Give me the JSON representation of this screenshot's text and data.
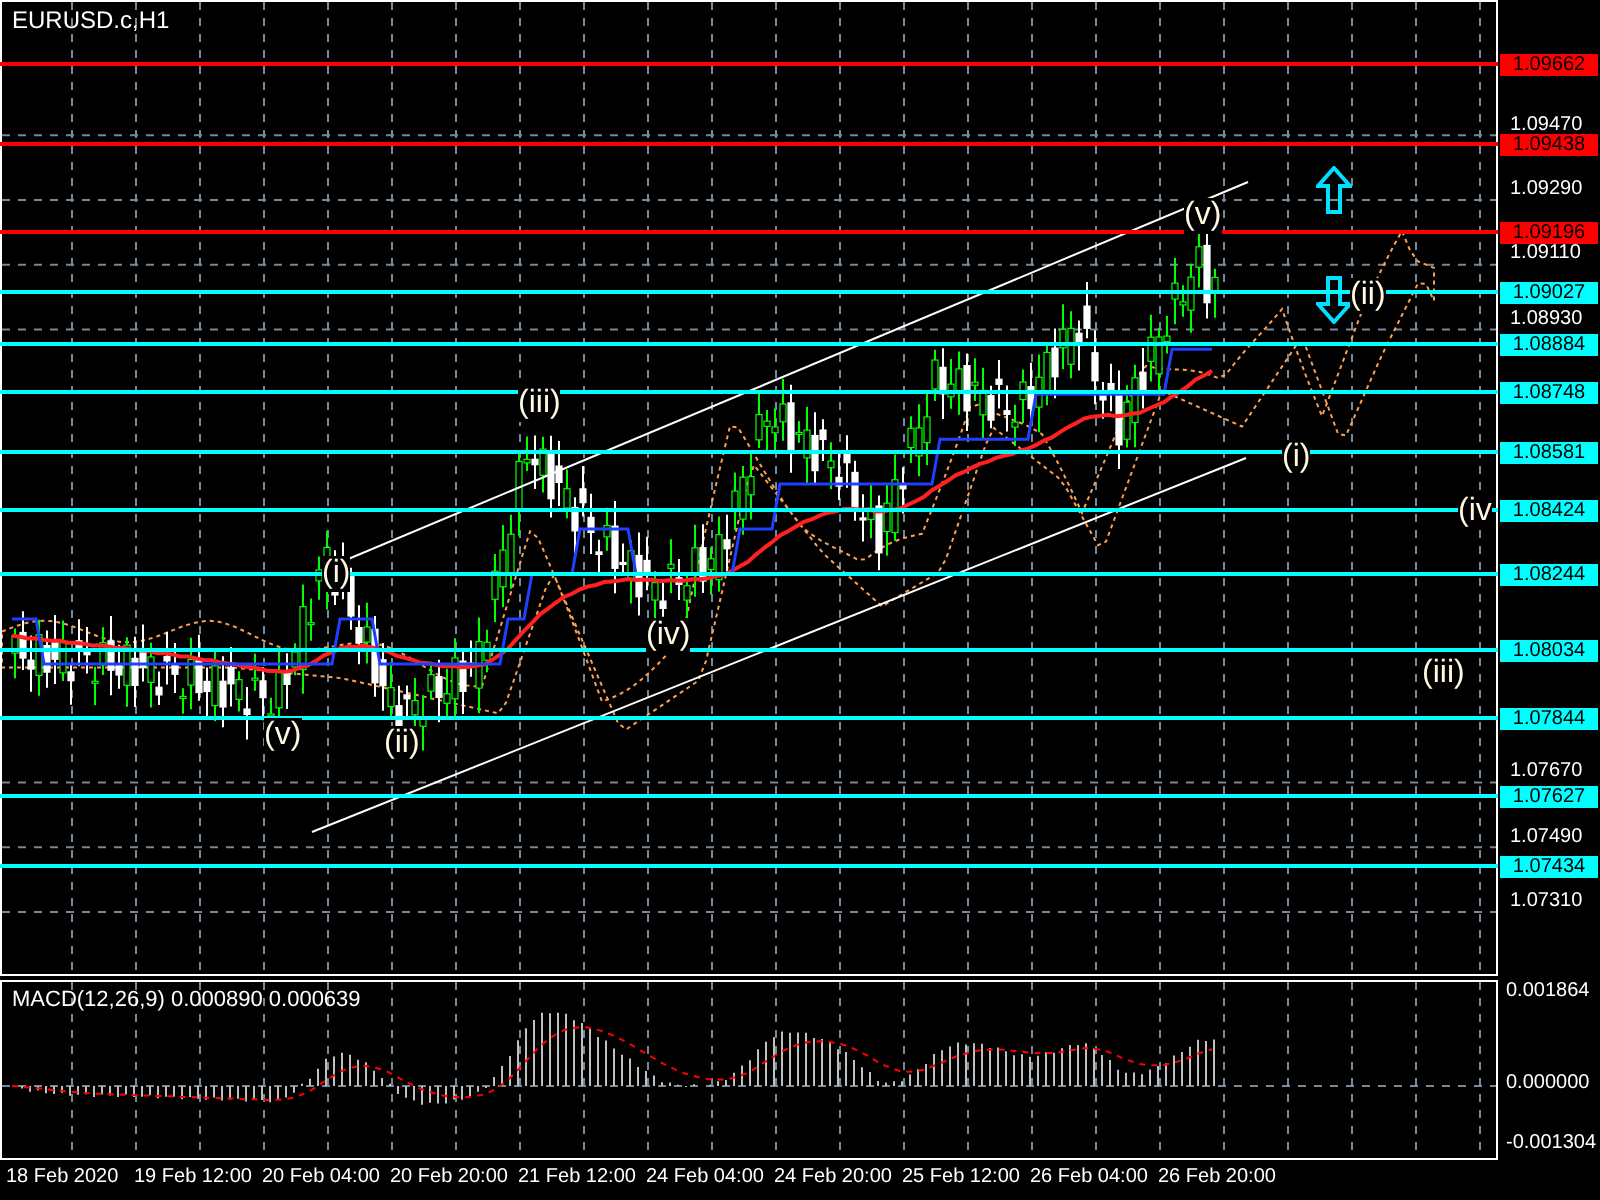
{
  "chart": {
    "title": "EURUSD.c,H1",
    "price_ticks": [
      "1.09470",
      "1.09290",
      "1.09110",
      "1.08930",
      "1.07670",
      "1.07490",
      "1.07310"
    ],
    "levels": [
      {
        "label": "1.09662",
        "color": "#ff0000"
      },
      {
        "label": "1.09438",
        "color": "#ff0000"
      },
      {
        "label": "1.09196",
        "color": "#ff0000"
      },
      {
        "label": "1.09027",
        "color": "#00ffff"
      },
      {
        "label": "1.08884",
        "color": "#00ffff"
      },
      {
        "label": "1.08748",
        "color": "#00ffff"
      },
      {
        "label": "1.08581",
        "color": "#00ffff"
      },
      {
        "label": "1.08424",
        "color": "#00ffff"
      },
      {
        "label": "1.08244",
        "color": "#00ffff"
      },
      {
        "label": "1.08034",
        "color": "#00ffff"
      },
      {
        "label": "1.07844",
        "color": "#00ffff"
      },
      {
        "label": "1.07627",
        "color": "#00ffff"
      },
      {
        "label": "1.07434",
        "color": "#00ffff"
      }
    ],
    "wave_labels": [
      "(v)",
      "(ii)",
      "(iii)",
      "(i)",
      "(iv",
      "(i)",
      "(iv)",
      "(iii)",
      "(v)",
      "(ii)"
    ]
  },
  "macd": {
    "title": "MACD(12,26,9) 0.000890 0.000639",
    "ticks": [
      "0.001864",
      "0.000000",
      "-0.001304"
    ]
  },
  "time_axis": {
    "labels": [
      "18 Feb 2020",
      "19 Feb 12:00",
      "20 Feb 04:00",
      "20 Feb 20:00",
      "21 Feb 12:00",
      "24 Feb 04:00",
      "24 Feb 20:00",
      "25 Feb 12:00",
      "26 Feb 04:00",
      "26 Feb 20:00"
    ]
  }
}
